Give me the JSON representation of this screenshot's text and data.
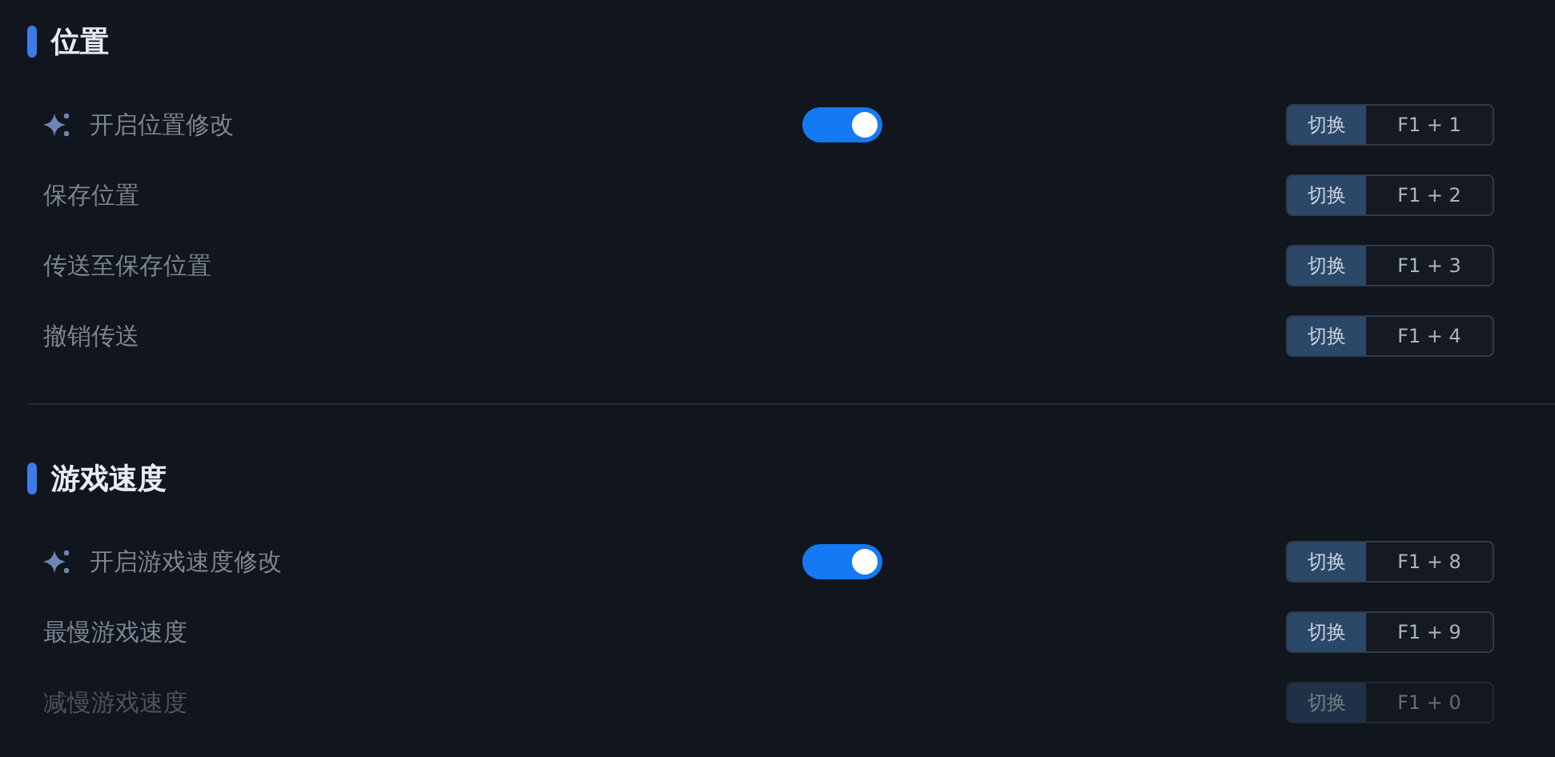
{
  "sections": [
    {
      "title": "位置",
      "items": [
        {
          "kind": "toggle",
          "label": "开启位置修改",
          "on": true,
          "disabled": false,
          "hotkey": {
            "action": "切换",
            "keys": "F1 + 1"
          }
        },
        {
          "kind": "action",
          "label": "保存位置",
          "disabled": false,
          "hotkey": {
            "action": "切换",
            "keys": "F1 + 2"
          }
        },
        {
          "kind": "action",
          "label": "传送至保存位置",
          "disabled": false,
          "hotkey": {
            "action": "切换",
            "keys": "F1 + 3"
          }
        },
        {
          "kind": "action",
          "label": "撤销传送",
          "disabled": false,
          "hotkey": {
            "action": "切换",
            "keys": "F1 + 4"
          }
        }
      ]
    },
    {
      "title": "游戏速度",
      "items": [
        {
          "kind": "toggle",
          "label": "开启游戏速度修改",
          "on": true,
          "disabled": false,
          "hotkey": {
            "action": "切换",
            "keys": "F1 + 8"
          }
        },
        {
          "kind": "action",
          "label": "最慢游戏速度",
          "disabled": false,
          "hotkey": {
            "action": "切换",
            "keys": "F1 + 9"
          }
        },
        {
          "kind": "action",
          "label": "减慢游戏速度",
          "disabled": true,
          "hotkey": {
            "action": "切换",
            "keys": "F1 + 0"
          }
        }
      ]
    }
  ]
}
